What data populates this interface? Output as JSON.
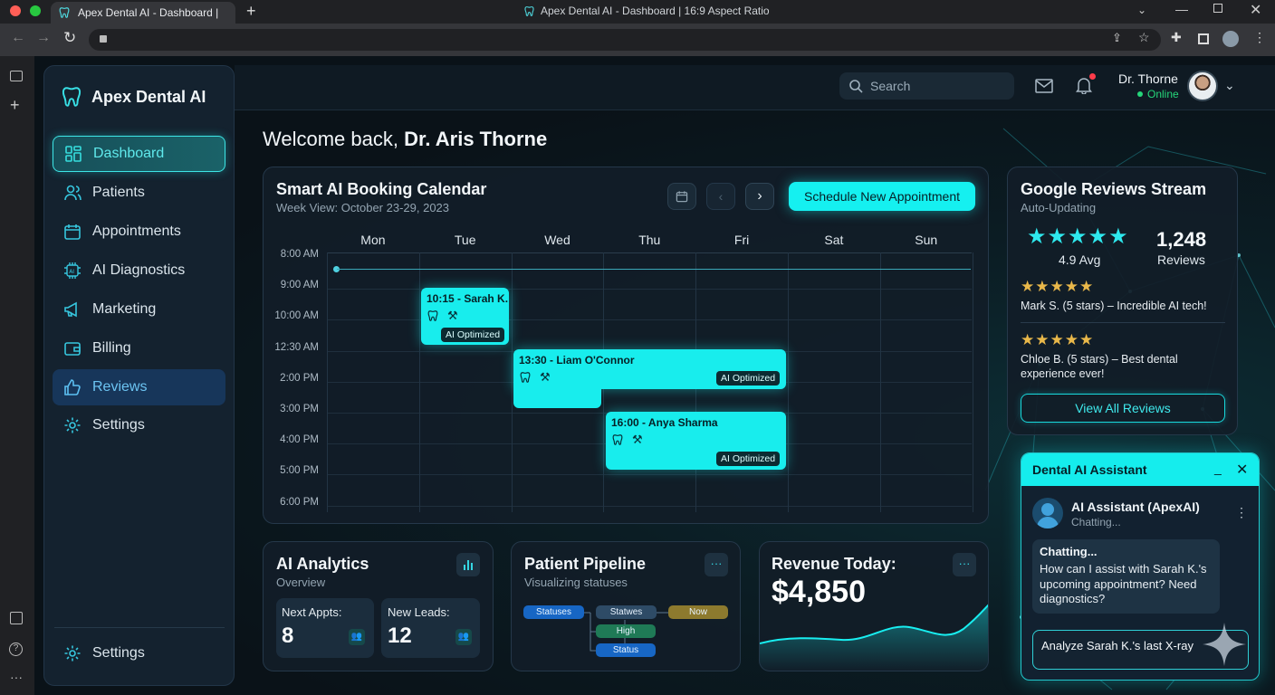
{
  "browser": {
    "tab_title": "Apex Dental AI - Dashboard | ",
    "window_title": "Apex Dental AI - Dashboard | 16:9 Aspect Ratio"
  },
  "brand": {
    "name": "Apex Dental AI"
  },
  "nav": {
    "items": [
      {
        "label": "Dashboard",
        "icon": "dashboard-icon"
      },
      {
        "label": "Patients",
        "icon": "users-icon"
      },
      {
        "label": "Appointments",
        "icon": "calendar-icon"
      },
      {
        "label": "AI Diagnostics",
        "icon": "ai-chip-icon"
      },
      {
        "label": "Marketing",
        "icon": "megaphone-icon"
      },
      {
        "label": "Billing",
        "icon": "wallet-icon"
      },
      {
        "label": "Reviews",
        "icon": "thumbs-up-icon"
      },
      {
        "label": "Settings",
        "icon": "gear-icon"
      }
    ],
    "footer": "Settings"
  },
  "header": {
    "search_placeholder": "Search",
    "user_name": "Dr. Thorne",
    "status": "Online"
  },
  "welcome": {
    "prefix": "Welcome back, ",
    "name": "Dr. Aris Thorne"
  },
  "calendar": {
    "title": "Smart AI Booking Calendar",
    "subtitle": "Week View: October 23-29, 2023",
    "cta": "Schedule New Appointment",
    "days": [
      "Mon",
      "Tue",
      "Wed",
      "Thu",
      "Fri",
      "Sat",
      "Sun"
    ],
    "times": [
      "8:00 AM",
      "9:00 AM",
      "10:00 AM",
      "12:30 AM",
      "2:00 PM",
      "3:00 PM",
      "4:00 PM",
      "5:00 PM",
      "6:00 PM"
    ],
    "events": [
      {
        "title": "10:15 - Sarah K.",
        "badge": "AI Optimized"
      },
      {
        "title": "13:30 - Liam O'Connor",
        "badge": "AI Optimized"
      },
      {
        "title": "16:00 - Anya Sharma",
        "badge": "AI Optimized"
      }
    ]
  },
  "reviews": {
    "title": "Google Reviews Stream",
    "subtitle": "Auto-Updating",
    "avg": "4.9 Avg",
    "rating": 4.9,
    "count": "1,248",
    "count_label": "Reviews",
    "items": [
      {
        "text": "Mark S. (5 stars) – Incredible AI tech!",
        "stars": 5
      },
      {
        "text": "Chloe B. (5 stars) – Best dental experience ever!",
        "stars": 5
      }
    ],
    "button": "View All Reviews"
  },
  "analytics": {
    "title": "AI Analytics",
    "subtitle": "Overview",
    "next_label": "Next Appts:",
    "next_value": "8",
    "leads_label": "New Leads:",
    "leads_value": "12"
  },
  "pipeline": {
    "title": "Patient Pipeline",
    "subtitle": "Visualizing statuses",
    "nodes": [
      "Statuses",
      "Statwes",
      "Now",
      "High",
      "Status"
    ]
  },
  "revenue": {
    "label": "Revenue Today:",
    "value": "$4,850"
  },
  "assistant": {
    "title": "Dental AI Assistant",
    "name": "AI Assistant (ApexAI)",
    "status": "Chatting...",
    "msg_title": "Chatting...",
    "msg_body": "How can I assist with Sarah K.'s upcoming appointment? Need diagnostics?",
    "input_value": "Analyze Sarah K.'s last X-ray"
  },
  "colors": {
    "accent": "#15f0f0",
    "brand_bg": "#0c1118",
    "active_nav": "#17365a",
    "gold": "#e9b84a"
  }
}
